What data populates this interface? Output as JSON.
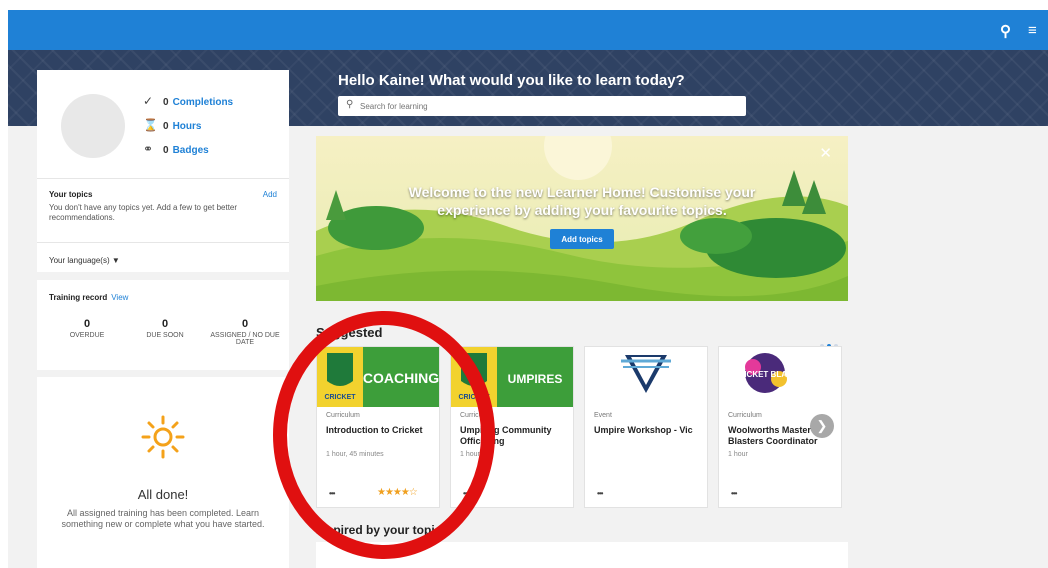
{
  "header": {
    "greeting": "Hello Kaine! What would you like to learn today?",
    "search_placeholder": "Search for learning"
  },
  "profile": {
    "completions_count": "0",
    "completions_label": "Completions",
    "hours_count": "0",
    "hours_label": "Hours",
    "badges_count": "0",
    "badges_label": "Badges"
  },
  "topics": {
    "title": "Your topics",
    "add_label": "Add",
    "message": "You don't have any topics yet. Add a few to get better recommendations.",
    "language_label": "Your language(s)"
  },
  "training": {
    "title": "Training record",
    "view_label": "View",
    "stats": [
      {
        "value": "0",
        "label": "OVERDUE"
      },
      {
        "value": "0",
        "label": "DUE SOON"
      },
      {
        "value": "0",
        "label": "ASSIGNED / NO DUE DATE"
      }
    ]
  },
  "done": {
    "title": "All done!",
    "message": "All assigned training has been completed. Learn something new or complete what you have started."
  },
  "banner": {
    "line1": "Welcome to the new Learner Home! Customise your",
    "line2": "experience by adding your favourite topics.",
    "button": "Add topics"
  },
  "suggested": {
    "title": "Suggested",
    "items": [
      {
        "type": "Curriculum",
        "title": "Introduction to Cricket",
        "duration": "1 hour, 45 minutes",
        "thumb_text": "COACHING",
        "logo_text": "CRICKET",
        "rating": 4.5
      },
      {
        "type": "Curriculum",
        "title": "Umpiring Community Officiating",
        "duration": "1 hour",
        "thumb_text": "UMPIRES",
        "logo_text": "CRICKET"
      },
      {
        "type": "Event",
        "title": "Umpire Workshop - Vic",
        "duration": ""
      },
      {
        "type": "Curriculum",
        "title": "Woolworths Master Blasters Coordinator",
        "duration": "1 hour",
        "thumb_text": "CRICKET BLAST"
      }
    ],
    "more_label": "•••"
  },
  "inspired": {
    "title": "Inspired by your topics"
  },
  "colors": {
    "topbar": "#1f81d6",
    "hero": "#2f4263",
    "link": "#1f81d6",
    "highlight_circle": "#e01010",
    "star": "#f0a020"
  }
}
